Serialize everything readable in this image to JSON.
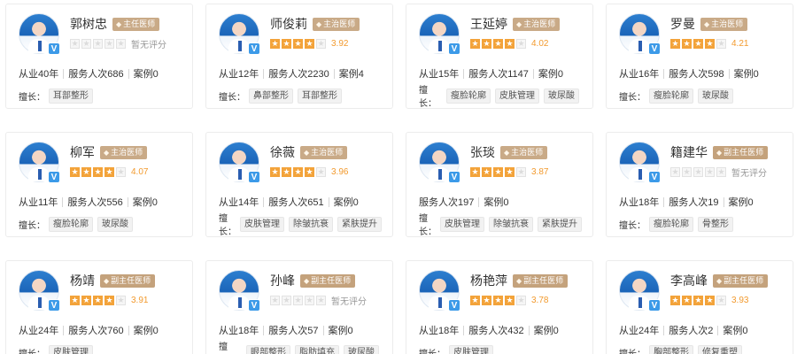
{
  "ui": {
    "no_rating_text": "暂无评分",
    "tags_label": "擅长：",
    "verified_mark": "V"
  },
  "colors": {
    "star_on": "#f3a33a",
    "star_off": "#f6f6f6",
    "score": "#f29a2e",
    "badge": "#c9aa87",
    "verified": "#3c9ae8"
  },
  "doctors": [
    {
      "name": "郭树忠",
      "title": "主任医师",
      "rating": 0,
      "score": "暂无评分",
      "stats": [
        "从业40年",
        "服务人次686",
        "案例0"
      ],
      "tags": [
        "耳部整形"
      ]
    },
    {
      "name": "师俊莉",
      "title": "主治医师",
      "rating": 4,
      "score": "3.92",
      "stats": [
        "从业12年",
        "服务人次2230",
        "案例4"
      ],
      "tags": [
        "鼻部整形",
        "耳部整形"
      ]
    },
    {
      "name": "王延婷",
      "title": "主治医师",
      "rating": 4,
      "score": "4.02",
      "stats": [
        "从业15年",
        "服务人次1147",
        "案例0"
      ],
      "tags": [
        "瘦脸轮廓",
        "皮肤管理",
        "玻尿酸"
      ]
    },
    {
      "name": "罗曼",
      "title": "主治医师",
      "rating": 4,
      "score": "4.21",
      "stats": [
        "从业16年",
        "服务人次598",
        "案例0"
      ],
      "tags": [
        "瘦脸轮廓",
        "玻尿酸"
      ]
    },
    {
      "name": "柳军",
      "title": "主治医师",
      "rating": 4,
      "score": "4.07",
      "stats": [
        "从业11年",
        "服务人次556",
        "案例0"
      ],
      "tags": [
        "瘦脸轮廓",
        "玻尿酸"
      ]
    },
    {
      "name": "徐薇",
      "title": "主治医师",
      "rating": 4,
      "score": "3.96",
      "stats": [
        "从业14年",
        "服务人次651",
        "案例0"
      ],
      "tags": [
        "皮肤管理",
        "除皱抗衰",
        "紧肤提升"
      ]
    },
    {
      "name": "张琰",
      "title": "主治医师",
      "rating": 4,
      "score": "3.87",
      "stats": [
        "服务人次197",
        "案例0"
      ],
      "tags": [
        "皮肤管理",
        "除皱抗衰",
        "紧肤提升"
      ]
    },
    {
      "name": "籍建华",
      "title": "副主任医师",
      "rating": 0,
      "score": "暂无评分",
      "stats": [
        "从业18年",
        "服务人次19",
        "案例0"
      ],
      "tags": [
        "瘦脸轮廓",
        "骨整形"
      ]
    },
    {
      "name": "杨靖",
      "title": "副主任医师",
      "rating": 4,
      "score": "3.91",
      "stats": [
        "从业24年",
        "服务人次760",
        "案例0"
      ],
      "tags": [
        "皮肤管理"
      ]
    },
    {
      "name": "孙峰",
      "title": "副主任医师",
      "rating": 0,
      "score": "暂无评分",
      "stats": [
        "从业18年",
        "服务人次57",
        "案例0"
      ],
      "tags": [
        "眼部整形",
        "脂肪填充",
        "玻尿酸"
      ]
    },
    {
      "name": "杨艳萍",
      "title": "副主任医师",
      "rating": 4,
      "score": "3.78",
      "stats": [
        "从业18年",
        "服务人次432",
        "案例0"
      ],
      "tags": [
        "皮肤管理"
      ]
    },
    {
      "name": "李高峰",
      "title": "副主任医师",
      "rating": 4,
      "score": "3.93",
      "stats": [
        "从业24年",
        "服务人次2",
        "案例0"
      ],
      "tags": [
        "胸部整形",
        "修复重塑"
      ]
    }
  ]
}
